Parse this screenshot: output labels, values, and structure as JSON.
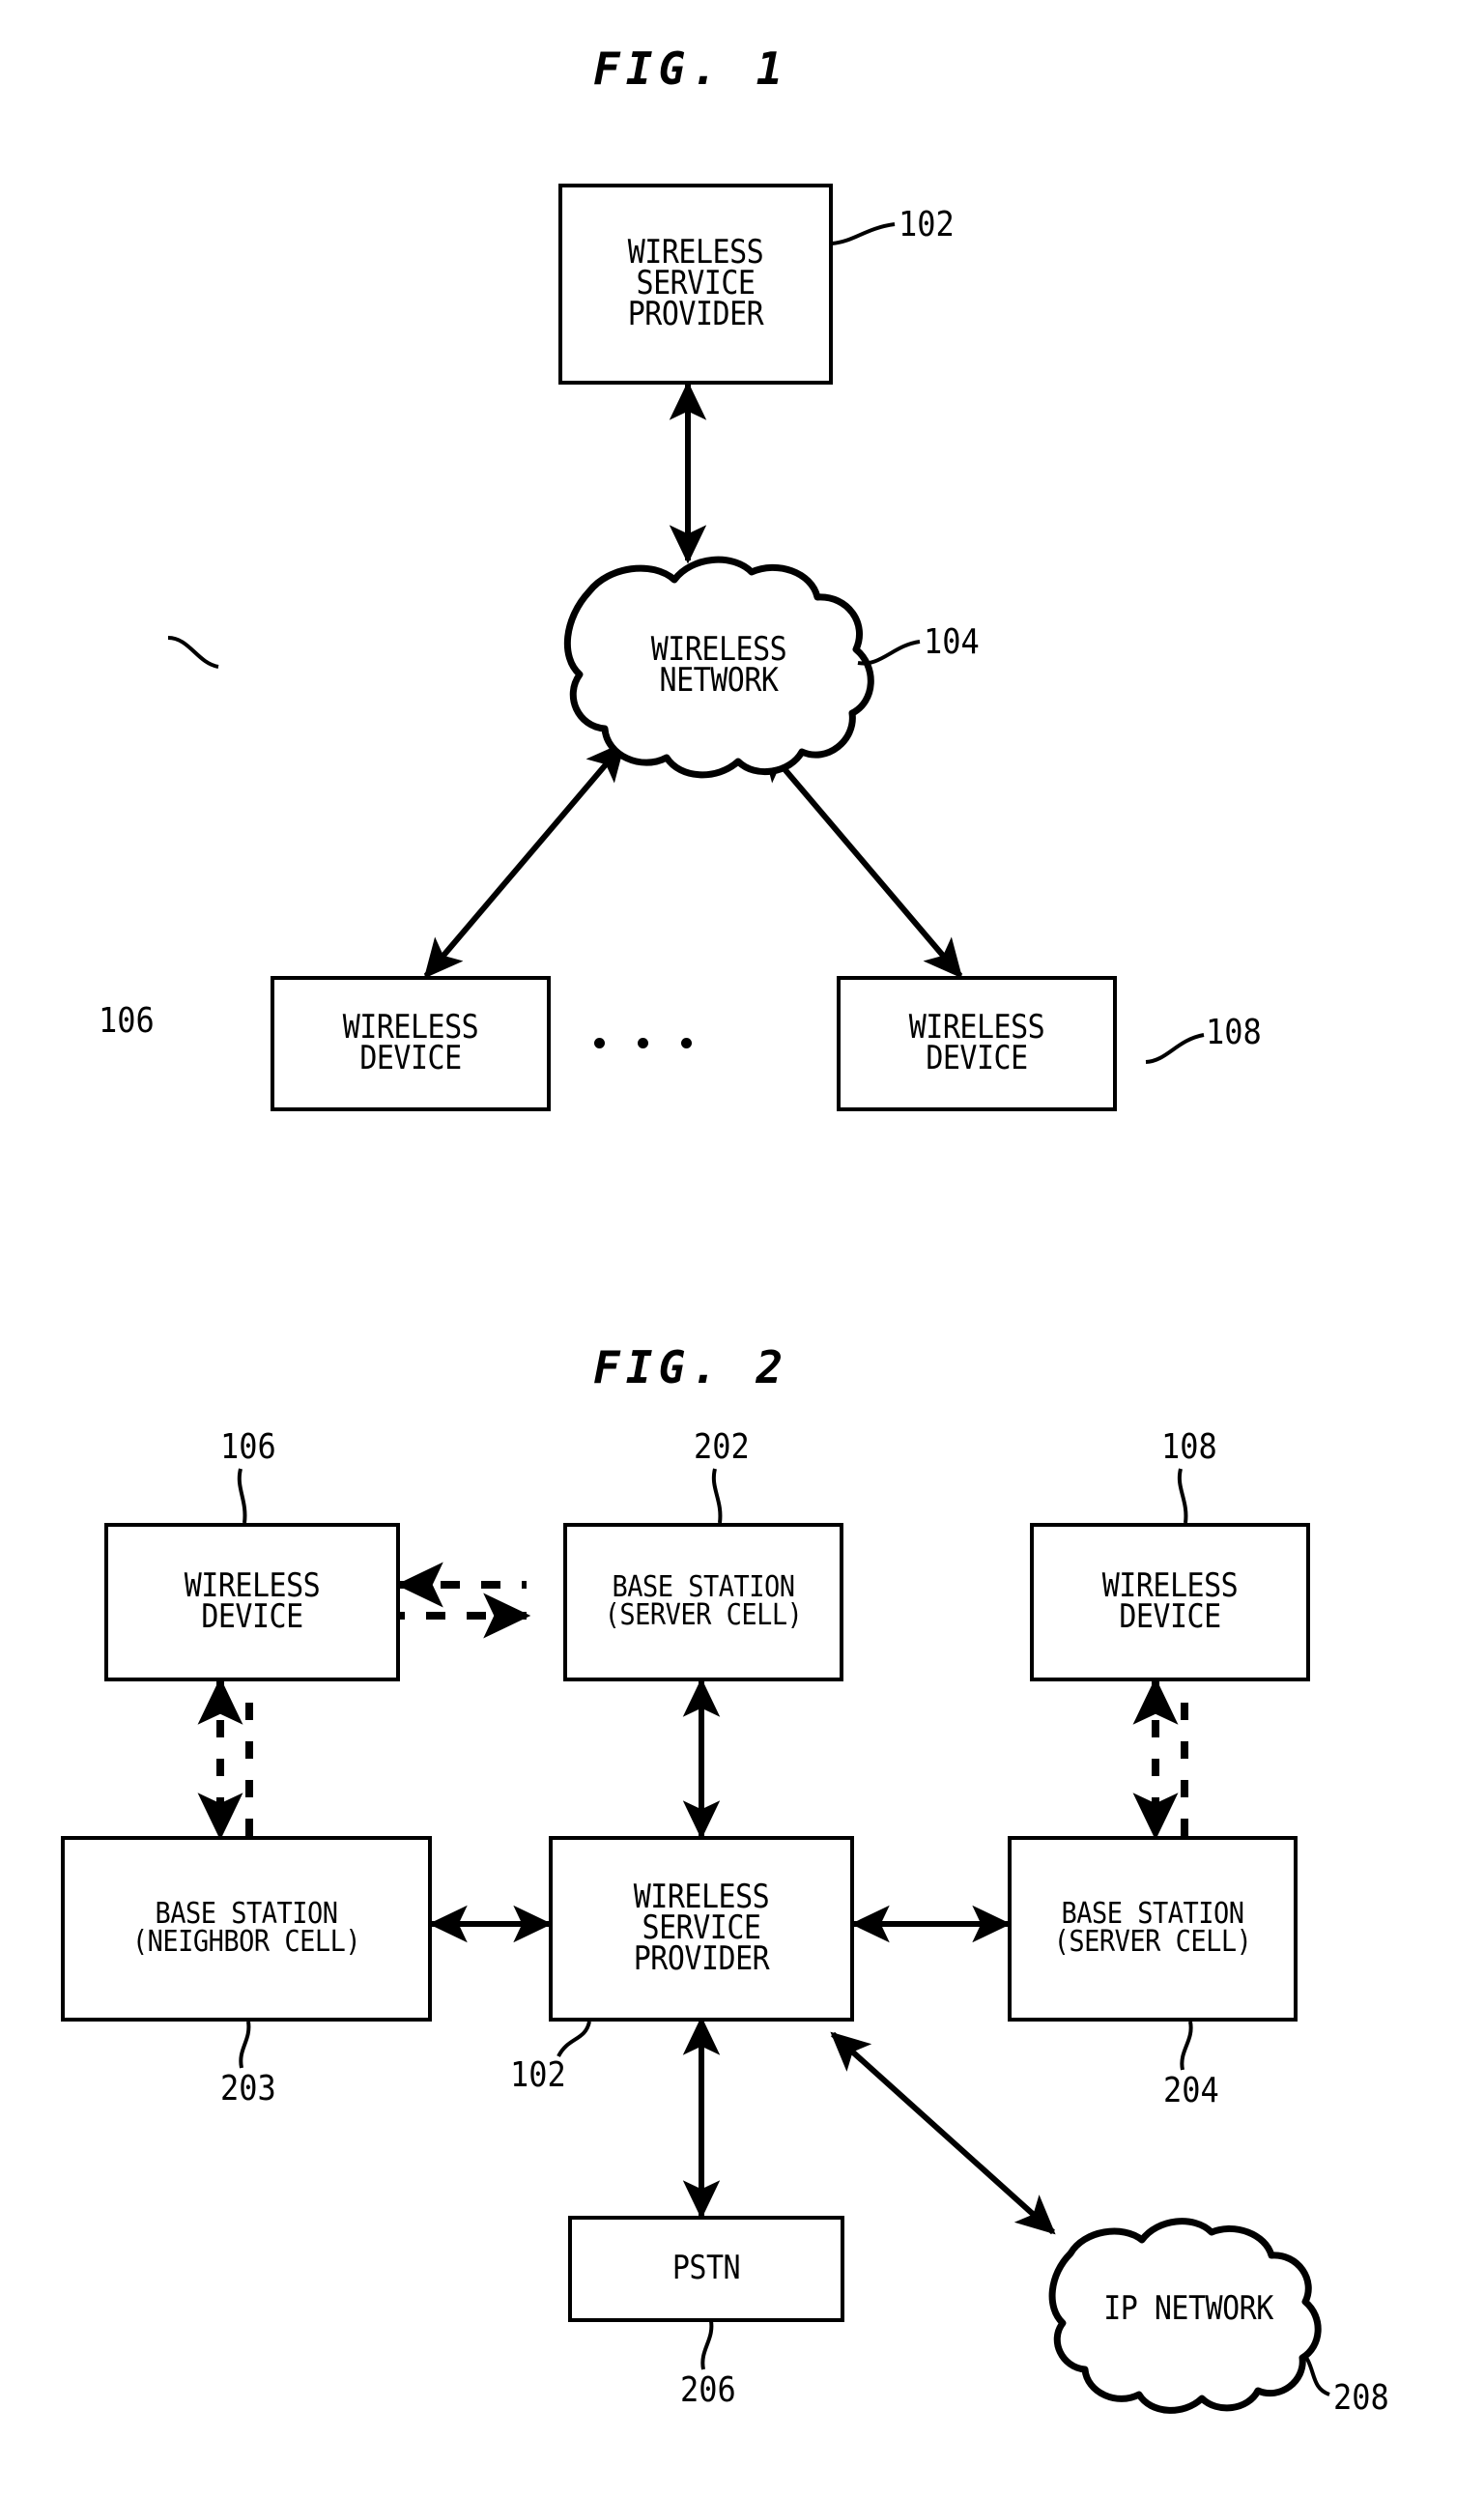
{
  "figures": [
    {
      "title": "FIG. 1",
      "nodes": [
        {
          "id": "wsp",
          "lines": [
            "WIRELESS",
            "SERVICE",
            "PROVIDER"
          ],
          "ref": "102"
        },
        {
          "id": "wireless-network",
          "lines": [
            "WIRELESS",
            "NETWORK"
          ],
          "ref": "104",
          "shape": "cloud"
        },
        {
          "id": "wireless-device-left",
          "lines": [
            "WIRELESS",
            "DEVICE"
          ],
          "ref": "106"
        },
        {
          "id": "wireless-device-right",
          "lines": [
            "WIRELESS",
            "DEVICE"
          ],
          "ref": "108"
        }
      ],
      "ellipsis": "..."
    },
    {
      "title": "FIG. 2",
      "nodes": [
        {
          "id": "wireless-device-106",
          "lines": [
            "WIRELESS",
            "DEVICE"
          ],
          "ref": "106"
        },
        {
          "id": "base-station-202",
          "lines": [
            "BASE STATION",
            "(SERVER CELL)"
          ],
          "ref": "202"
        },
        {
          "id": "wireless-device-108",
          "lines": [
            "WIRELESS",
            "DEVICE"
          ],
          "ref": "108"
        },
        {
          "id": "base-station-203",
          "lines": [
            "BASE STATION",
            "(NEIGHBOR CELL)"
          ],
          "ref": "203"
        },
        {
          "id": "wireless-service-provider-102",
          "lines": [
            "WIRELESS",
            "SERVICE",
            "PROVIDER"
          ],
          "ref": "102"
        },
        {
          "id": "base-station-204",
          "lines": [
            "BASE STATION",
            "(SERVER CELL)"
          ],
          "ref": "204"
        },
        {
          "id": "pstn-206",
          "lines": [
            "PSTN"
          ],
          "ref": "206"
        },
        {
          "id": "ip-network-208",
          "lines": [
            "IP NETWORK"
          ],
          "ref": "208",
          "shape": "cloud"
        }
      ]
    }
  ],
  "fig1": {
    "title": "FIG. 1",
    "wsp": {
      "l1": "WIRELESS",
      "l2": "SERVICE",
      "l3": "PROVIDER",
      "ref": "102"
    },
    "network": {
      "l1": "WIRELESS",
      "l2": "NETWORK",
      "ref": "104"
    },
    "device_left": {
      "l1": "WIRELESS",
      "l2": "DEVICE",
      "ref": "106"
    },
    "device_right": {
      "l1": "WIRELESS",
      "l2": "DEVICE",
      "ref": "108"
    }
  },
  "fig2": {
    "title": "FIG. 2",
    "device_106": {
      "l1": "WIRELESS",
      "l2": "DEVICE",
      "ref": "106"
    },
    "bs_202": {
      "l1": "BASE STATION",
      "l2": "(SERVER CELL)",
      "ref": "202"
    },
    "device_108": {
      "l1": "WIRELESS",
      "l2": "DEVICE",
      "ref": "108"
    },
    "bs_203": {
      "l1": "BASE STATION",
      "l2": "(NEIGHBOR CELL)",
      "ref": "203"
    },
    "wsp_102": {
      "l1": "WIRELESS",
      "l2": "SERVICE",
      "l3": "PROVIDER",
      "ref": "102"
    },
    "bs_204": {
      "l1": "BASE STATION",
      "l2": "(SERVER CELL)",
      "ref": "204"
    },
    "pstn": {
      "l1": "PSTN",
      "ref": "206"
    },
    "ip_network": {
      "l1": "IP NETWORK",
      "ref": "208"
    }
  },
  "colors": {
    "ink": "#000000",
    "paper": "#ffffff"
  }
}
